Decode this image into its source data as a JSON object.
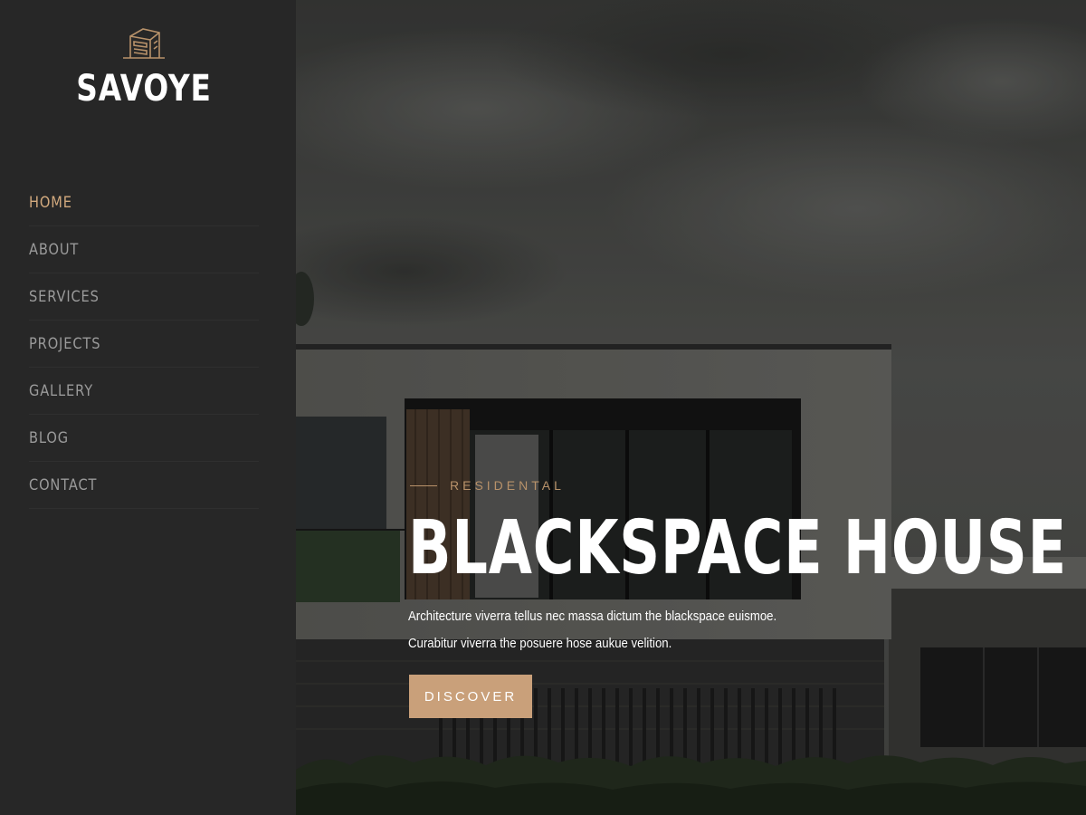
{
  "brand": {
    "name": "SAVOYE",
    "logo_icon": "building-logo-icon"
  },
  "nav": {
    "items": [
      {
        "label": "HOME",
        "active": true
      },
      {
        "label": "ABOUT",
        "active": false
      },
      {
        "label": "SERVICES",
        "active": false
      },
      {
        "label": "PROJECTS",
        "active": false
      },
      {
        "label": "GALLERY",
        "active": false
      },
      {
        "label": "BLOG",
        "active": false
      },
      {
        "label": "CONTACT",
        "active": false
      }
    ]
  },
  "hero": {
    "eyebrow": "RESIDENTAL",
    "title": "BLACKSPACE HOUSE",
    "description_line1": "Architecture viverra tellus nec massa dictum the blackspace euismoe.",
    "description_line2": "Curabitur viverra the posuere hose aukue velition.",
    "button_label": "DISCOVER"
  },
  "colors": {
    "sidebar_bg": "#272727",
    "accent": "#c9a07a",
    "nav_text": "#9a9a9a",
    "nav_active": "#d3aa7e"
  }
}
